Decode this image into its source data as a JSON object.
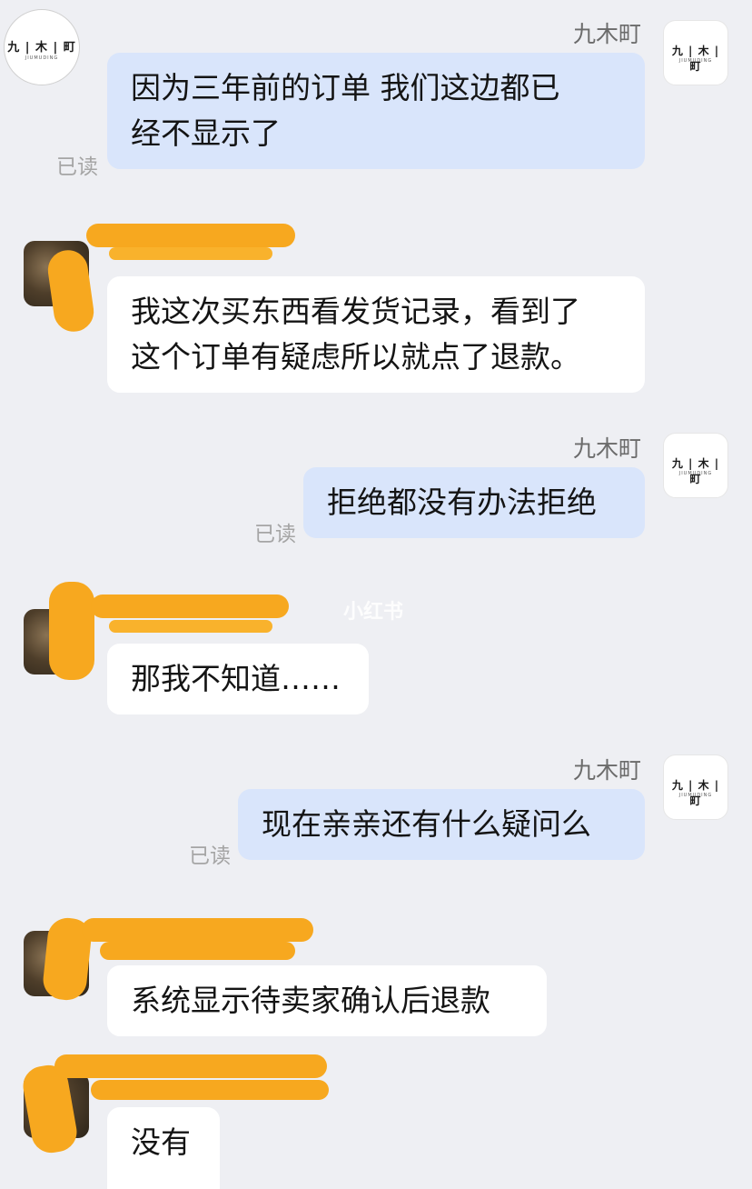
{
  "watermark": "小红书",
  "messages": [
    {
      "side": "self",
      "sender": "九木町",
      "text_lines": [
        "因为三年前的订单 我们这边都已",
        "经不显示了"
      ],
      "status": "已读"
    },
    {
      "side": "other",
      "text_lines": [
        "我这次买东西看发货记录，看到了",
        "这个订单有疑虑所以就点了退款。"
      ]
    },
    {
      "side": "self",
      "sender": "九木町",
      "text_lines": [
        "拒绝都没有办法拒绝"
      ],
      "status": "已读"
    },
    {
      "side": "other",
      "text_lines": [
        "那我不知道……"
      ]
    },
    {
      "side": "self",
      "sender": "九木町",
      "text_lines": [
        "现在亲亲还有什么疑问么"
      ],
      "status": "已读"
    },
    {
      "side": "other",
      "text_lines": [
        "系统显示待卖家确认后退款"
      ]
    },
    {
      "side": "other",
      "text_lines": [
        "没有"
      ]
    }
  ],
  "shop_avatar": {
    "logo": "九 | 木 | 町",
    "sub": "JIUMUDING"
  },
  "colors": {
    "self_bubble": "#d9e5fb",
    "other_bubble": "#ffffff",
    "background": "#eeeff3",
    "redaction": "#f7a81f"
  }
}
